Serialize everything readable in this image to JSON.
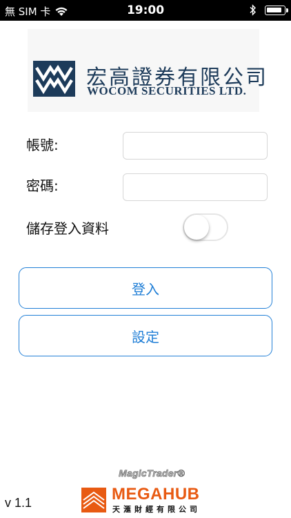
{
  "status_bar": {
    "carrier": "無 SIM 卡",
    "time": "19:00",
    "battery_level": 0.9
  },
  "logo": {
    "company_chinese": "宏高證券有限公司",
    "company_english": "WOCOM SECURITIES LTD."
  },
  "form": {
    "account_label": "帳號:",
    "account_value": "",
    "password_label": "密碼:",
    "password_value": "",
    "remember_label": "儲存登入資料",
    "remember_on": false
  },
  "buttons": {
    "login_label": "登入",
    "settings_label": "設定"
  },
  "footer": {
    "version": "v 1.1",
    "magictrader": "MagicTrader®",
    "megahub_name": "MEGAHUB",
    "megahub_sub": "天滙財經有限公司"
  },
  "colors": {
    "accent": "#1f7ed6",
    "brand_navy": "#1d3b5a",
    "megahub_orange": "#e85a12"
  },
  "icons": [
    "wifi-icon",
    "bluetooth-icon",
    "battery-icon",
    "wocom-logo-icon",
    "megahub-logo-icon"
  ]
}
